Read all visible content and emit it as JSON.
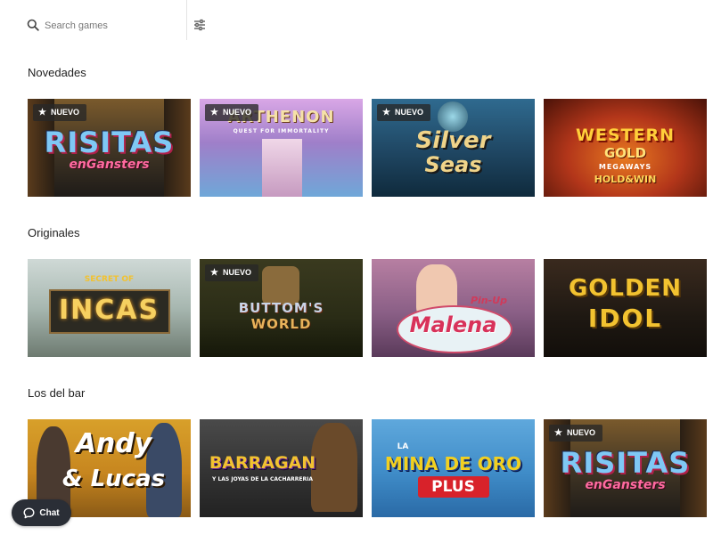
{
  "search": {
    "placeholder": "Search games"
  },
  "sections": [
    {
      "title": "Novedades",
      "games": [
        {
          "title_main": "RISITAS",
          "title_sub": "enGansters",
          "badge": "NUEVO"
        },
        {
          "title_main": "ARTHENON",
          "title_sub": "QUEST FOR IMMORTALITY",
          "badge": "NUEVO"
        },
        {
          "title_main": "Silver",
          "title_sub": "Seas",
          "badge": "NUEVO"
        },
        {
          "title_main": "WESTERN",
          "title_sub": "GOLD",
          "title_extra": "MEGAWAYS",
          "title_extra2": "HOLD&WIN"
        }
      ]
    },
    {
      "title": "Originales",
      "games": [
        {
          "title_main": "INCAS",
          "title_sub": "SECRET OF"
        },
        {
          "title_main": "BUTTOM'S",
          "title_sub": "WORLD",
          "badge": "NUEVO"
        },
        {
          "title_main": "Malena",
          "title_sub": "Pin-Up"
        },
        {
          "title_main": "GOLDEN",
          "title_sub": "IDOL"
        }
      ]
    },
    {
      "title": "Los del bar",
      "games": [
        {
          "title_main": "Andy",
          "title_sub": "& Lucas"
        },
        {
          "title_main": "BARRAGAN",
          "title_sub": "Y LAS JOYAS DE LA CACHARRERIA"
        },
        {
          "title_main": "MINA DE ORO",
          "title_sub": "PLUS",
          "title_extra": "LA"
        },
        {
          "title_main": "RISITAS",
          "title_sub": "enGansters",
          "badge": "NUEVO"
        }
      ]
    }
  ],
  "chat": {
    "label": "Chat"
  },
  "colors": {
    "badge_bg": "#2b2b2b",
    "chat_bg": "#2a2e36",
    "accent_gold": "#f2c230"
  }
}
